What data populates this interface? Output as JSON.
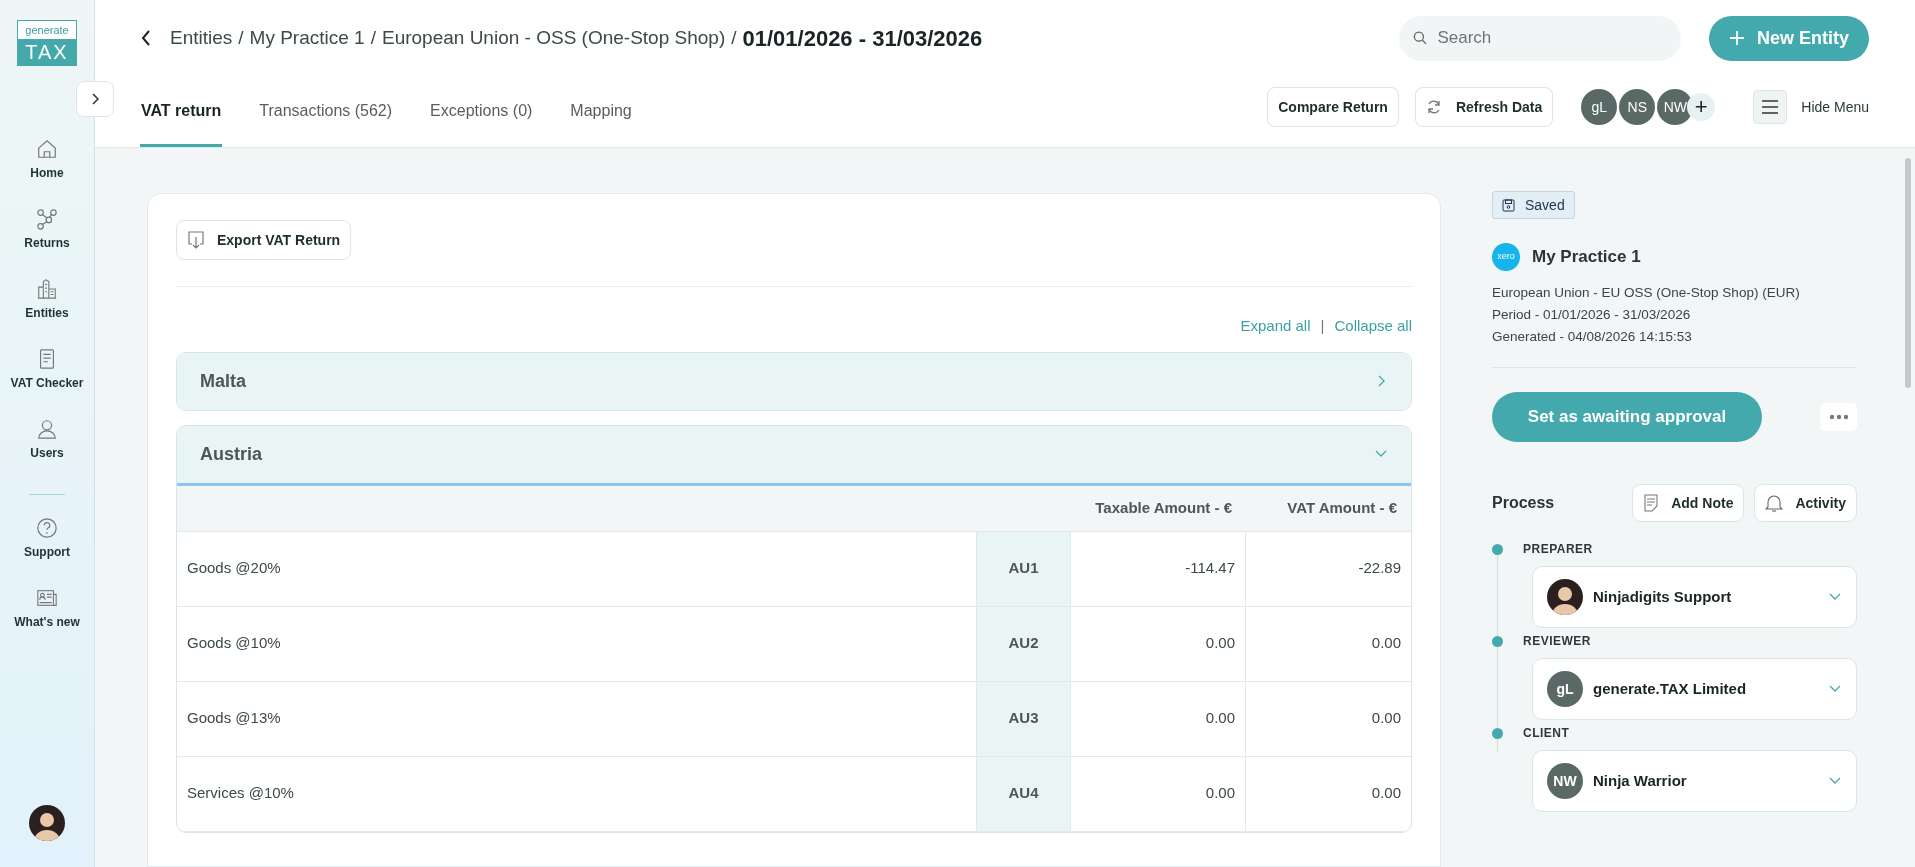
{
  "sidebar": {
    "logo_top": "generate",
    "logo_bottom": "TAX",
    "groups": [
      [
        {
          "label": "Home"
        },
        {
          "label": "Returns"
        },
        {
          "label": "Entities"
        },
        {
          "label": "VAT Checker"
        },
        {
          "label": "Users"
        }
      ],
      [
        {
          "label": "Support"
        },
        {
          "label": "What's new"
        }
      ]
    ]
  },
  "header": {
    "breadcrumb": [
      "Entities",
      "My Practice 1",
      "European Union - OSS (One-Stop Shop)"
    ],
    "separator": "/",
    "current": "01/01/2026 - 31/03/2026",
    "search": {
      "placeholder": "Search"
    },
    "new_button": "New Entity"
  },
  "tabs": [
    {
      "label": "VAT return",
      "selected": true
    },
    {
      "label": "Transactions (562)",
      "selected": false
    },
    {
      "label": "Exceptions (0)",
      "selected": false
    },
    {
      "label": "Mapping",
      "selected": false
    }
  ],
  "toolbar": {
    "compare_button": "Compare Return",
    "refresh_button": "Refresh Data",
    "avatars": [
      "gL",
      "NS",
      "NW"
    ],
    "add": "+",
    "hide_menu": "Hide Menu"
  },
  "return": {
    "export_button": "Export VAT Return",
    "expand_all": "Expand all",
    "divider": "|",
    "collapse_all": "Collapse all",
    "sections": [
      {
        "name": "Malta",
        "expanded": false
      },
      {
        "name": "Austria",
        "expanded": true,
        "columns": [
          "Taxable Amount - €",
          "VAT Amount - €"
        ],
        "rows": [
          {
            "label": "Goods @20%",
            "code": "AU1",
            "taxable": "-114.47",
            "vat": "-22.89"
          },
          {
            "label": "Goods @10%",
            "code": "AU2",
            "taxable": "0.00",
            "vat": "0.00"
          },
          {
            "label": "Goods @13%",
            "code": "AU3",
            "taxable": "0.00",
            "vat": "0.00"
          },
          {
            "label": "Services @10%",
            "code": "AU4",
            "taxable": "0.00",
            "vat": "0.00"
          }
        ]
      }
    ]
  },
  "panel": {
    "saved": "Saved",
    "logo_text": "xero",
    "practice": "My Practice 1",
    "details": [
      "European Union - EU OSS (One-Stop Shop) (EUR)",
      "Period - 01/01/2026 - 31/03/2026",
      "Generated - 04/08/2026 14:15:53"
    ],
    "approve_button": "Set as awaiting approval",
    "process_title": "Process",
    "add_note": "Add Note",
    "activity": "Activity",
    "roles": [
      {
        "role": "PREPARER",
        "name": "Ninjadigits Support",
        "kind": "photo"
      },
      {
        "role": "REVIEWER",
        "name": "generate.TAX Limited",
        "kind": "initials",
        "initials": "gL"
      },
      {
        "role": "CLIENT",
        "name": "Ninja Warrior",
        "kind": "initials",
        "initials": "NW"
      }
    ]
  }
}
